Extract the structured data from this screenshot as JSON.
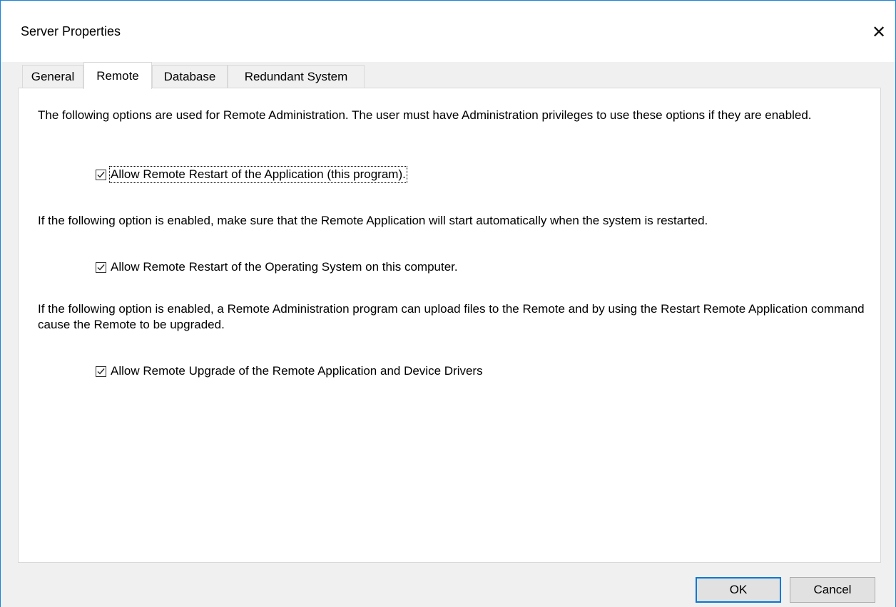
{
  "window": {
    "title": "Server Properties",
    "close_glyph": "✕"
  },
  "tabs": [
    {
      "label": "General",
      "active": false
    },
    {
      "label": "Remote",
      "active": true
    },
    {
      "label": "Database",
      "active": false
    },
    {
      "label": "Redundant System",
      "active": false
    }
  ],
  "remote": {
    "intro_text": "The following options are used for Remote Administration. The user must have Administration privileges to use these options if they are enabled.",
    "option1_label": "Allow Remote Restart of the Application (this program).",
    "option1_checked": true,
    "note2_text": "If the following option is enabled, make sure that the Remote Application will start automatically when the system is restarted.",
    "option2_label": "Allow Remote Restart of the Operating System on this computer.",
    "option2_checked": true,
    "note3_text": "If the following option is enabled, a Remote Administration program can upload files to the Remote and by using the Restart Remote Application command cause the Remote to be upgraded.",
    "option3_label": "Allow Remote Upgrade of the Remote Application and Device Drivers",
    "option3_checked": true
  },
  "buttons": {
    "ok_label": "OK",
    "cancel_label": "Cancel"
  },
  "colors": {
    "accent": "#0078d7",
    "window_border": "#1883d7"
  }
}
